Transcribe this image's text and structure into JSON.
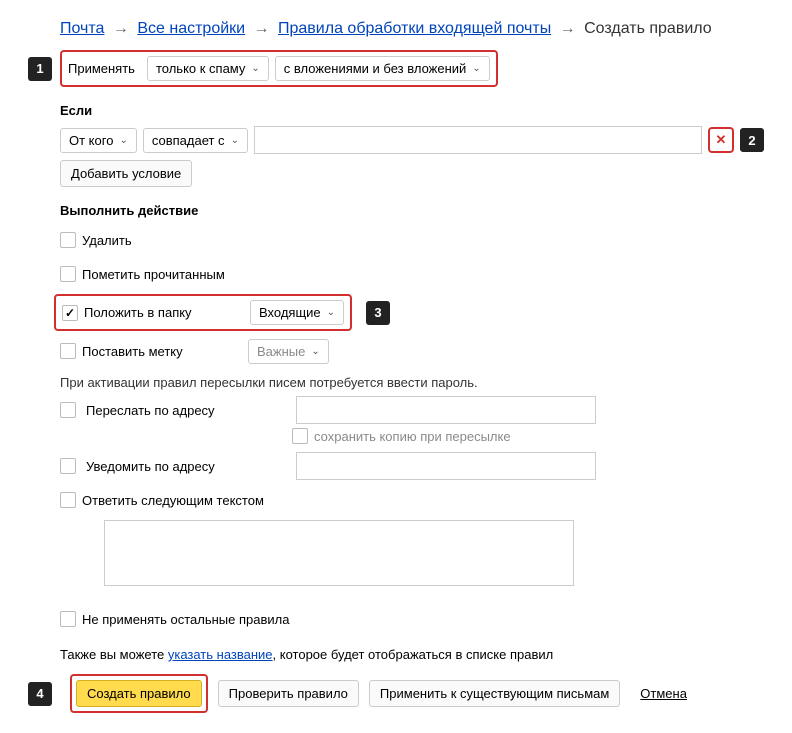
{
  "breadcrumb": {
    "mail": "Почта",
    "settings": "Все настройки",
    "rules": "Правила обработки входящей почты",
    "current": "Создать правило"
  },
  "apply": {
    "label": "Применять",
    "spam_select": "только к спаму",
    "attachments_select": "с вложениями и без вложений"
  },
  "condition": {
    "title": "Если",
    "field_select": "От кого",
    "match_select": "совпадает с",
    "value": "",
    "add_button": "Добавить условие"
  },
  "actions": {
    "title": "Выполнить действие",
    "delete": "Удалить",
    "mark_read": "Пометить прочитанным",
    "move_folder": "Положить в папку",
    "folder_select": "Входящие",
    "set_label": "Поставить метку",
    "label_select": "Важные",
    "forward_help": "При активации правил пересылки писем потребуется ввести пароль.",
    "forward": "Переслать по адресу",
    "keep_copy": "сохранить копию при пересылке",
    "notify": "Уведомить по адресу",
    "reply": "Ответить следующим текстом",
    "reply_value": "",
    "skip_others": "Не применять остальные правила"
  },
  "footer": {
    "note_before": "Также вы можете ",
    "note_link": "указать название",
    "note_after": ", которое будет отображаться в списке правил",
    "create": "Создать правило",
    "check": "Проверить правило",
    "apply_existing": "Применить к существующим письмам",
    "cancel": "Отмена"
  },
  "callouts": {
    "c1": "1",
    "c2": "2",
    "c3": "3",
    "c4": "4"
  }
}
